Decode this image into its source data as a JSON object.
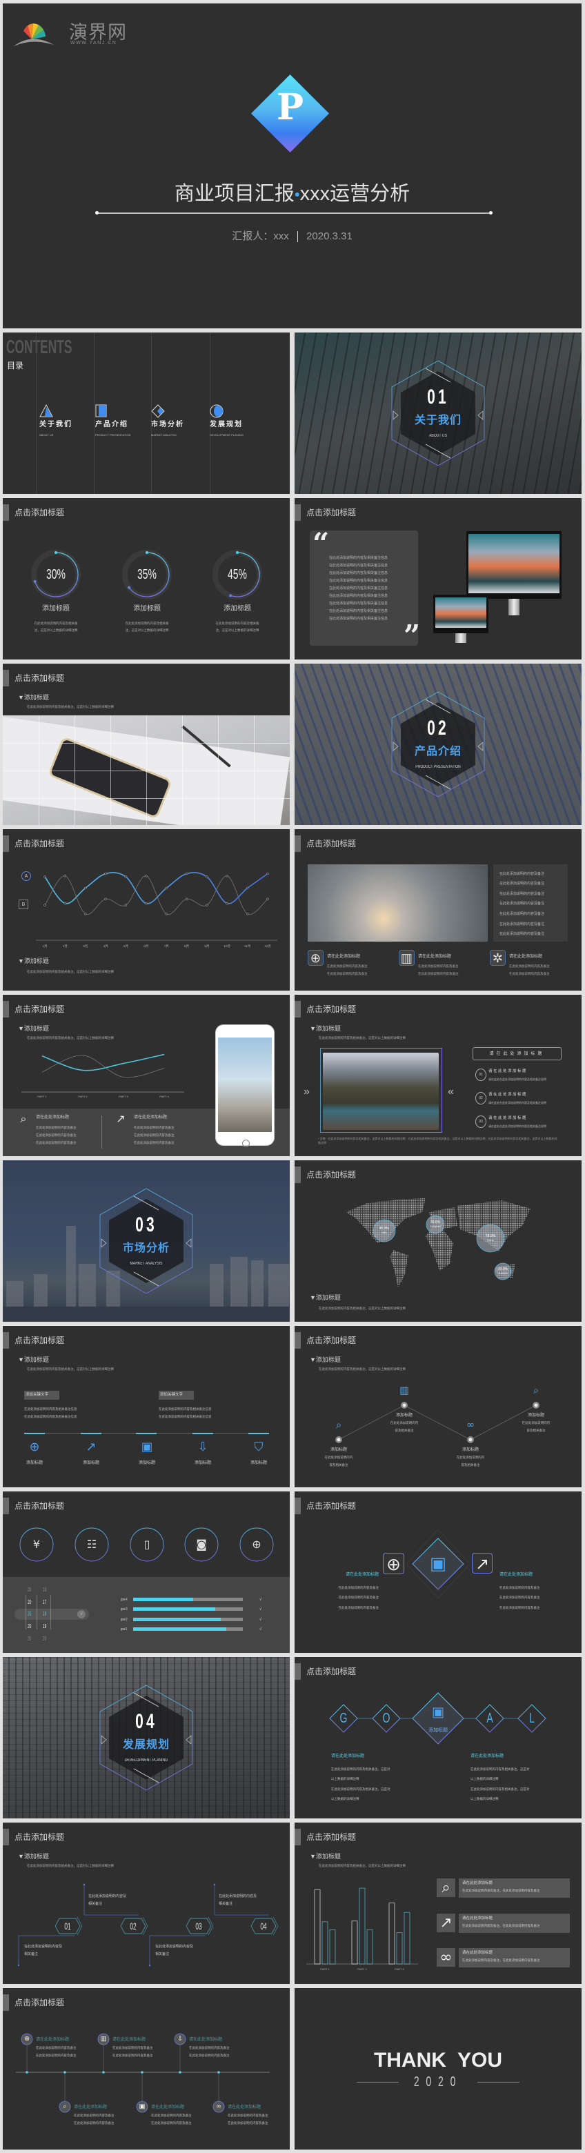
{
  "brand": {
    "name": "演界网",
    "url": "WWW.YANJ.CN"
  },
  "cover": {
    "logo_letter": "P",
    "title_left": "商业项目汇报",
    "title_dot": "•",
    "title_right": "xxx运营分析",
    "reporter": "汇报人：xxx",
    "date": "2020.3.31"
  },
  "colors": {
    "background": "#2f2f2f",
    "accent_blue": "#4aa3f0",
    "accent_teal": "#4fd3ea",
    "accent_purple": "#7b6fe0",
    "page": "#e1e1e1"
  },
  "common": {
    "slide_title": "点击添加标题",
    "subtitle": "▼添加标题",
    "desc": "在此处添加说明的内容及相关备注，这是对以上数据的详细注释",
    "item_title": "添加标题",
    "ask_title": "请在此处添加标题",
    "note_line": "在此处添加说明的内容及相关备注信息",
    "short_line": "在此处添加说明的内容及备注",
    "ring_desc_1": "在此处添加说明的内容及相关备",
    "ring_desc_2": "注，这是对以上数据的详细注释",
    "check": "√"
  },
  "contents": {
    "heading": "CONTENTS",
    "heading_cn": "目录",
    "items": [
      {
        "cn": "关于我们",
        "en": "ABOUT US",
        "icon": "triangle-icon"
      },
      {
        "cn": "产品介绍",
        "en": "PRODUCT PRESENTATION",
        "icon": "square-icon"
      },
      {
        "cn": "市场分析",
        "en": "MARKET ANALYSIS",
        "icon": "diamond-icon"
      },
      {
        "cn": "发展规划",
        "en": "DEVELOPMENT PLANING",
        "icon": "half-circle-icon"
      }
    ]
  },
  "sections": [
    {
      "num": "01",
      "cn": "关于我们",
      "en": "ABOUT US"
    },
    {
      "num": "02",
      "cn": "产品介绍",
      "en": "PRODUCT PRESENTATION"
    },
    {
      "num": "03",
      "cn": "市场分析",
      "en": "MARKET ANALYSIS"
    },
    {
      "num": "04",
      "cn": "发展规划",
      "en": "DEVELOPMENT PLANING"
    }
  ],
  "rings": [
    {
      "label": "30%",
      "value": 30
    },
    {
      "label": "35%",
      "value": 35
    },
    {
      "label": "45%",
      "value": 45
    }
  ],
  "product_icons": [
    "globe-pin-icon",
    "bar-chart-icon",
    "gear-network-icon"
  ],
  "split_icons": [
    "folder-search-icon",
    "chart-growth-icon"
  ],
  "list": {
    "nums": [
      "01",
      "02",
      "03"
    ],
    "desc": "请在此处在此处添加说明的内容及相关备注说明",
    "footnote": "* 注释：在此处添加说明的内容及相关备注，这是对以上数据的详细注释；在此处添加说明的内容及相关备注，这是对以上数据的详细注释；在此处添加说明的内容及相关备注，这是对以上数据的详细注释"
  },
  "map": {
    "bubbles": [
      {
        "pct": "45.9%",
        "region": "USA"
      },
      {
        "pct": "30.6%",
        "region": "European"
      },
      {
        "pct": "78.9%",
        "region": "China"
      },
      {
        "pct": "20.3%",
        "region": "Australia"
      }
    ]
  },
  "keyword": "添加关键文字",
  "timeline_icons": [
    "globe-pin-icon",
    "chart-growth-icon",
    "presentation-icon",
    "inbox-download-icon",
    "badge-icon"
  ],
  "zigzag": {
    "line1": "在此处添加说明的内",
    "line2": "容及相关备注",
    "icons": [
      "folder-search-icon",
      "bar-chart-icon",
      "link-icon",
      "search-chart-icon"
    ]
  },
  "circle_icons": [
    "money-bag-icon",
    "contact-book-icon",
    "battery-icon",
    "camera-icon",
    "globe-icon"
  ],
  "years": [
    {
      "a": "20",
      "b": "16"
    },
    {
      "a": "20",
      "b": "17"
    },
    {
      "a": "20",
      "b": "18",
      "selected": true
    },
    {
      "a": "20",
      "b": "19"
    },
    {
      "a": "20",
      "b": "20"
    }
  ],
  "goals": [
    {
      "label": "goal 4",
      "value": 55
    },
    {
      "label": "goal 3",
      "value": 75
    },
    {
      "label": "goal 2",
      "value": 80
    },
    {
      "label": "goal 1",
      "value": 85
    }
  ],
  "goal_word": {
    "letters": [
      "G",
      "O",
      "A",
      "L"
    ],
    "desc_1": "在此处添加说明的内容及相关备注，这是对",
    "desc_2": "以上数据的详细注释"
  },
  "hex_steps": {
    "nums": [
      "01",
      "02",
      "03",
      "04"
    ],
    "line1": "在此处添加说明的内容及",
    "line2": "相关备注"
  },
  "cards": {
    "desc": "在此处添加说明内容及备注，在此处添加说明内容及备注",
    "icons": [
      "folder-search-icon",
      "chart-growth-icon",
      "link-icon"
    ]
  },
  "timeline6_icons": [
    "globe-icon",
    "folder-search-icon",
    "bar-chart-icon",
    "presentation-icon",
    "inbox-download-icon",
    "link-icon"
  ],
  "thanks": {
    "title": "THANK  YOU",
    "year": "2020"
  },
  "chart_data": [
    {
      "type": "line",
      "categories": [
        "1月",
        "2月",
        "3月",
        "4月",
        "5月",
        "6月",
        "7月",
        "8月",
        "9月",
        "10月",
        "11月",
        "12月"
      ],
      "series": [
        {
          "name": "A",
          "values": [
            88,
            27,
            62,
            95,
            88,
            27,
            62,
            95,
            88,
            27,
            62,
            95
          ]
        },
        {
          "name": "B",
          "values": [
            23,
            90,
            3,
            37,
            23,
            90,
            3,
            37,
            23,
            90,
            3,
            37
          ]
        }
      ],
      "grid": false
    },
    {
      "type": "line",
      "categories": [
        "PART 1",
        "PART 2",
        "PART 3",
        "PART 4"
      ],
      "series": [
        {
          "values": [
            83,
            35,
            58,
            88
          ]
        },
        {
          "values": [
            29,
            85,
            12,
            42
          ]
        }
      ],
      "grid": false
    },
    {
      "type": "bar",
      "categories": [
        "PART 1",
        "PART 2",
        "PART 3"
      ],
      "series": [
        {
          "values": [
            95,
            55,
            78
          ]
        },
        {
          "values": [
            54,
            97,
            40
          ]
        },
        {
          "values": [
            44,
            44,
            66
          ]
        }
      ],
      "grid": false
    }
  ]
}
